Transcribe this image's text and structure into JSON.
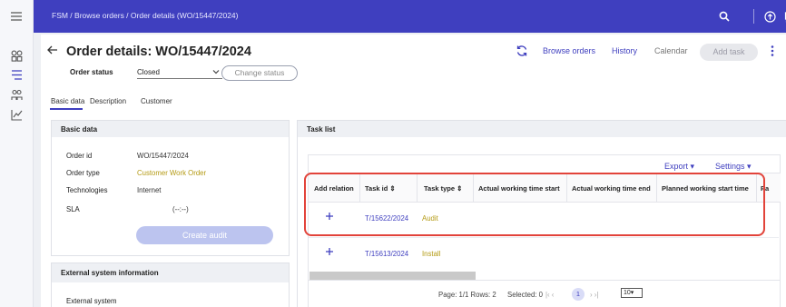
{
  "breadcrumb": "FSM / Browse orders / Order details (WO/15447/2024)",
  "page_title": "Order details: WO/15447/2024",
  "order_status": {
    "label": "Order status",
    "value": "Closed",
    "change_label": "Change status"
  },
  "actions": {
    "browse_orders": "Browse orders",
    "history": "History",
    "calendar": "Calendar",
    "add_task": "Add task"
  },
  "tabs": [
    "Basic data",
    "Description",
    "Customer"
  ],
  "basic_data": {
    "header": "Basic data",
    "rows": [
      {
        "label": "Order id",
        "value": "WO/15447/2024"
      },
      {
        "label": "Order type",
        "value": "Customer Work Order"
      },
      {
        "label": "Technologies",
        "value": "Internet"
      },
      {
        "label": "SLA",
        "value": "(--:--)"
      }
    ],
    "create_audit": "Create audit"
  },
  "external": {
    "header": "External system information",
    "label": "External system"
  },
  "task_list": {
    "header": "Task list",
    "export": "Export ▾",
    "settings": "Settings ▾",
    "columns": [
      "Add relation",
      "Task id ⇕",
      "Task type ⇕",
      "Actual working time start",
      "Actual working time end",
      "Planned working start time",
      "Pa"
    ],
    "rows": [
      {
        "task_id": "T/15622/2024",
        "task_type": "Audit"
      },
      {
        "task_id": "T/15613/2024",
        "task_type": "Install"
      }
    ],
    "pager": {
      "text": "Page: 1/1 Rows: 2",
      "selected": "Selected: 0",
      "first_prev": "|‹  ‹",
      "page": "1",
      "next_last": "›  ›|",
      "size": "10▾"
    }
  },
  "colors": {
    "primary": "#3f3fbf",
    "highlight": "#e2433a",
    "gold": "#b49a14"
  }
}
